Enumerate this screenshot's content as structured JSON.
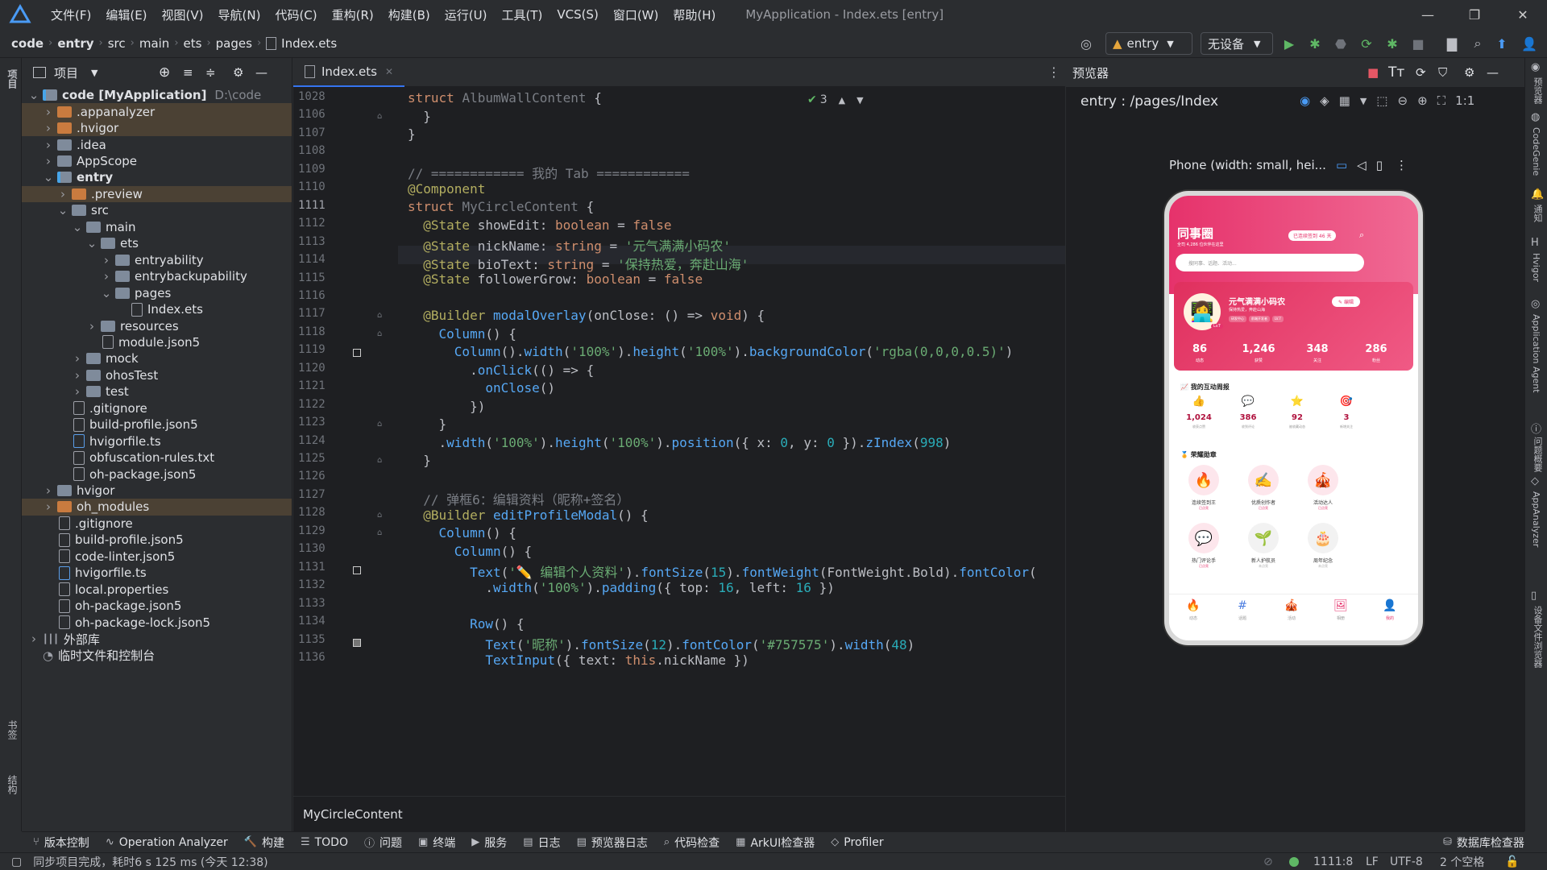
{
  "menubar": {
    "items": [
      "文件(F)",
      "编辑(E)",
      "视图(V)",
      "导航(N)",
      "代码(C)",
      "重构(R)",
      "构建(B)",
      "运行(U)",
      "工具(T)",
      "VCS(S)",
      "窗口(W)",
      "帮助(H)"
    ],
    "window_title": "MyApplication - Index.ets [entry]"
  },
  "navbar": {
    "breadcrumbs": [
      "code",
      "entry",
      "src",
      "main",
      "ets",
      "pages",
      "Index.ets"
    ],
    "run_config": "entry",
    "device": "无设备"
  },
  "project": {
    "title": "项目",
    "tree": [
      {
        "label": "code [MyApplication]",
        "extra": "D:\\code",
        "depth": 0,
        "type": "module",
        "open": true,
        "bold": true
      },
      {
        "label": ".appanalyzer",
        "depth": 1,
        "type": "folder-o",
        "open": false,
        "style": "excl"
      },
      {
        "label": ".hvigor",
        "depth": 1,
        "type": "folder-o",
        "open": false,
        "style": "excl"
      },
      {
        "label": ".idea",
        "depth": 1,
        "type": "folder",
        "open": false
      },
      {
        "label": "AppScope",
        "depth": 1,
        "type": "folder",
        "open": false
      },
      {
        "label": "entry",
        "depth": 1,
        "type": "module",
        "open": true,
        "bold": true
      },
      {
        "label": ".preview",
        "depth": 2,
        "type": "folder-o",
        "open": false,
        "style": "excl"
      },
      {
        "label": "src",
        "depth": 2,
        "type": "folder",
        "open": true
      },
      {
        "label": "main",
        "depth": 3,
        "type": "folder",
        "open": true
      },
      {
        "label": "ets",
        "depth": 4,
        "type": "folder",
        "open": true
      },
      {
        "label": "entryability",
        "depth": 5,
        "type": "folder",
        "open": false
      },
      {
        "label": "entrybackupability",
        "depth": 5,
        "type": "folder",
        "open": false
      },
      {
        "label": "pages",
        "depth": 5,
        "type": "folder",
        "open": true
      },
      {
        "label": "Index.ets",
        "depth": 6,
        "type": "file"
      },
      {
        "label": "resources",
        "depth": 4,
        "type": "folder",
        "open": false
      },
      {
        "label": "module.json5",
        "depth": 4,
        "type": "file"
      },
      {
        "label": "mock",
        "depth": 3,
        "type": "folder",
        "open": false
      },
      {
        "label": "ohosTest",
        "depth": 3,
        "type": "folder",
        "open": false
      },
      {
        "label": "test",
        "depth": 3,
        "type": "folder",
        "open": false
      },
      {
        "label": ".gitignore",
        "depth": 2,
        "type": "file"
      },
      {
        "label": "build-profile.json5",
        "depth": 2,
        "type": "file"
      },
      {
        "label": "hvigorfile.ts",
        "depth": 2,
        "type": "file-ts"
      },
      {
        "label": "obfuscation-rules.txt",
        "depth": 2,
        "type": "file"
      },
      {
        "label": "oh-package.json5",
        "depth": 2,
        "type": "file"
      },
      {
        "label": "hvigor",
        "depth": 1,
        "type": "folder",
        "open": false
      },
      {
        "label": "oh_modules",
        "depth": 1,
        "type": "folder-o",
        "open": false,
        "style": "excl"
      },
      {
        "label": ".gitignore",
        "depth": 1,
        "type": "file"
      },
      {
        "label": "build-profile.json5",
        "depth": 1,
        "type": "file"
      },
      {
        "label": "code-linter.json5",
        "depth": 1,
        "type": "file"
      },
      {
        "label": "hvigorfile.ts",
        "depth": 1,
        "type": "file-ts"
      },
      {
        "label": "local.properties",
        "depth": 1,
        "type": "file"
      },
      {
        "label": "oh-package.json5",
        "depth": 1,
        "type": "file"
      },
      {
        "label": "oh-package-lock.json5",
        "depth": 1,
        "type": "file"
      },
      {
        "label": "外部库",
        "depth": 0,
        "type": "lib",
        "open": false
      },
      {
        "label": "临时文件和控制台",
        "depth": 0,
        "type": "scratch"
      }
    ]
  },
  "editor": {
    "tab": "Index.ets",
    "inspection_count": "3",
    "current_line": "1111",
    "line_numbers": [
      "1028",
      "1106",
      "1107",
      "1108",
      "1109",
      "1110",
      "1111",
      "1112",
      "1113",
      "1114",
      "1115",
      "1116",
      "1117",
      "1118",
      "1119",
      "1120",
      "1121",
      "1122",
      "1123",
      "1124",
      "1125",
      "1126",
      "1127",
      "1128",
      "1129",
      "1130",
      "1131",
      "1132",
      "1133",
      "1134",
      "1135",
      "1136"
    ],
    "breadcrumb": "MyCircleContent"
  },
  "preview": {
    "title": "预览器",
    "route": "entry : /pages/Index",
    "device_label": "Phone (width: small, hei...",
    "phone": {
      "title": "同事圈",
      "subtitle": "全司 4,286 位伙伴在这里",
      "streak": "已连续签到 46 天",
      "search_placeholder": "搜同事、话题、活动...",
      "name": "元气满满小码农",
      "bio": "保持热爱，奔赴山海",
      "edit": "编辑",
      "tags": [
        "研发中心",
        "前端开发者",
        "LV.7"
      ],
      "level": "Lv7",
      "stats": [
        {
          "v": "86",
          "l": "动态"
        },
        {
          "v": "1,246",
          "l": "获赞"
        },
        {
          "v": "348",
          "l": "关注"
        },
        {
          "v": "286",
          "l": "粉丝"
        }
      ],
      "weekly_title": "我的互动周报",
      "weekly": [
        {
          "icon": "👍",
          "v": "1,024",
          "l": "收获点赞"
        },
        {
          "icon": "💬",
          "v": "386",
          "l": "收到评论"
        },
        {
          "icon": "⭐",
          "v": "92",
          "l": "被收藏动态"
        },
        {
          "icon": "🎯",
          "v": "3",
          "l": "新增关注"
        }
      ],
      "badges_title": "荣耀勋章",
      "badges": [
        {
          "icon": "🔥",
          "l": "连续签到王",
          "s": "已点亮"
        },
        {
          "icon": "✍️",
          "l": "优质创作者",
          "s": "已点亮"
        },
        {
          "icon": "🎪",
          "l": "活动达人",
          "s": "已点亮"
        },
        {
          "icon": "💬",
          "l": "热门评论手",
          "s": "已点亮"
        },
        {
          "icon": "🌱",
          "l": "新人护航员",
          "s": "未点亮"
        },
        {
          "icon": "🎂",
          "l": "周年纪念",
          "s": "未点亮"
        }
      ],
      "nav": [
        {
          "icon": "🔥",
          "l": "动态"
        },
        {
          "icon": "#",
          "l": "话题"
        },
        {
          "icon": "🎪",
          "l": "活动"
        },
        {
          "icon": "🖼",
          "l": "相册"
        },
        {
          "icon": "👤",
          "l": "我的"
        }
      ]
    }
  },
  "leftstrip": {
    "top": "项目",
    "bottom1": "书签",
    "bottom2": "结构"
  },
  "rightstrip": [
    "预览器",
    "CodeGenie",
    "通知",
    "Hvigor",
    "Application Agent",
    "问题概要",
    "AppAnalyzer",
    "设备文件浏览器"
  ],
  "bottom_tools": [
    {
      "icon": "⑂",
      "l": "版本控制"
    },
    {
      "icon": "∿",
      "l": "Operation Analyzer"
    },
    {
      "icon": "🔨",
      "l": "构建"
    },
    {
      "icon": "☰",
      "l": "TODO"
    },
    {
      "icon": "ⓘ",
      "l": "问题"
    },
    {
      "icon": "▣",
      "l": "终端"
    },
    {
      "icon": "▶",
      "l": "服务"
    },
    {
      "icon": "▤",
      "l": "日志"
    },
    {
      "icon": "▤",
      "l": "预览器日志"
    },
    {
      "icon": "⌕",
      "l": "代码检查"
    },
    {
      "icon": "▦",
      "l": "ArkUI检查器"
    },
    {
      "icon": "◇",
      "l": "Profiler"
    }
  ],
  "db_tool": "数据库检查器",
  "status": {
    "message": "同步项目完成，耗时6 s 125 ms (今天 12:38)",
    "position": "1111:8",
    "eol": "LF",
    "encoding": "UTF-8",
    "indent": "2 个空格"
  },
  "colors": {
    "accent": "#3574f0",
    "pink": "#e6326b"
  }
}
